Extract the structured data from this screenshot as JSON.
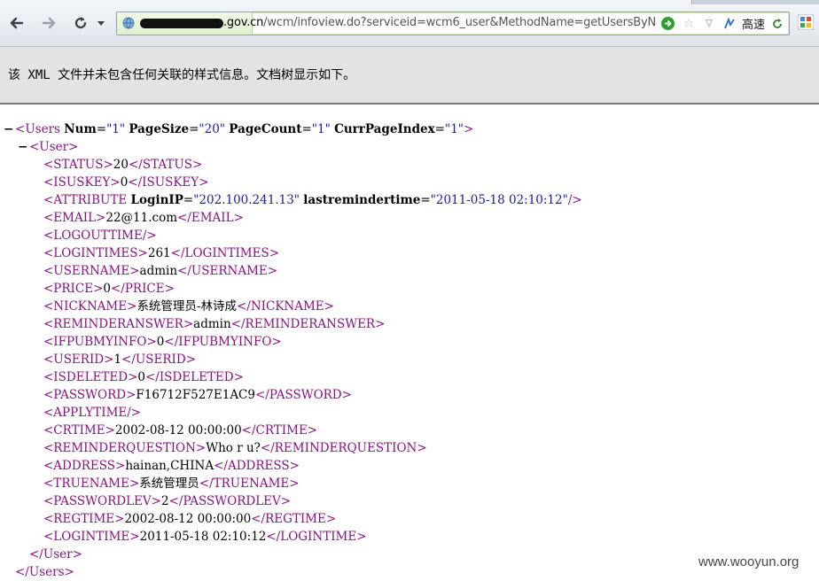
{
  "browser": {
    "url_domain": ".gov.cn",
    "url_path": "/wcm/infoview.do?serviceid=wcm6_user&MethodName=getUsersByNames&UserNa",
    "speed_label": "高速",
    "tab_label": "…"
  },
  "banner": {
    "message": "该 XML 文件并未包含任何关联的样式信息。文档树显示如下。"
  },
  "xml": {
    "users_tag": "Users",
    "users_attrs": [
      {
        "name": "Num",
        "value": "1"
      },
      {
        "name": "PageSize",
        "value": "20"
      },
      {
        "name": "PageCount",
        "value": "1"
      },
      {
        "name": "CurrPageIndex",
        "value": "1"
      }
    ],
    "user_tag": "User",
    "attribute_tag": "ATTRIBUTE",
    "attribute_attrs": [
      {
        "name": "LoginIP",
        "value": "202.100.241.13"
      },
      {
        "name": "lastremindertime",
        "value": "2011-05-18 02:10:12"
      }
    ],
    "fields": [
      {
        "tag": "STATUS",
        "value": "20"
      },
      {
        "tag": "ISUSKEY",
        "value": "0"
      },
      {
        "tag": "EMAIL",
        "value": "22@11.com"
      },
      {
        "tag": "LOGOUTTIME",
        "value": null
      },
      {
        "tag": "LOGINTIMES",
        "value": "261"
      },
      {
        "tag": "USERNAME",
        "value": "admin"
      },
      {
        "tag": "PRICE",
        "value": "0"
      },
      {
        "tag": "NICKNAME",
        "value": "系统管理员-林诗成"
      },
      {
        "tag": "REMINDERANSWER",
        "value": "admin"
      },
      {
        "tag": "IFPUBMYINFO",
        "value": "0"
      },
      {
        "tag": "USERID",
        "value": "1"
      },
      {
        "tag": "ISDELETED",
        "value": "0"
      },
      {
        "tag": "PASSWORD",
        "value": "F16712F527E1AC9"
      },
      {
        "tag": "APPLYTIME",
        "value": null
      },
      {
        "tag": "CRTIME",
        "value": "2002-08-12 00:00:00"
      },
      {
        "tag": "REMINDERQUESTION",
        "value": "Who r u?"
      },
      {
        "tag": "ADDRESS",
        "value": "hainan,CHINA"
      },
      {
        "tag": "TRUENAME",
        "value": "系统管理员"
      },
      {
        "tag": "PASSWORDLEV",
        "value": "2"
      },
      {
        "tag": "REGTIME",
        "value": "2002-08-12 00:00:00"
      },
      {
        "tag": "LOGINTIME",
        "value": "2011-05-18 02:10:12"
      }
    ]
  },
  "watermark": "www.wooyun.org",
  "colors": {
    "tag": "#881280",
    "attr_value": "#1a1aa6",
    "banner_bg": "#e3e3e3"
  }
}
